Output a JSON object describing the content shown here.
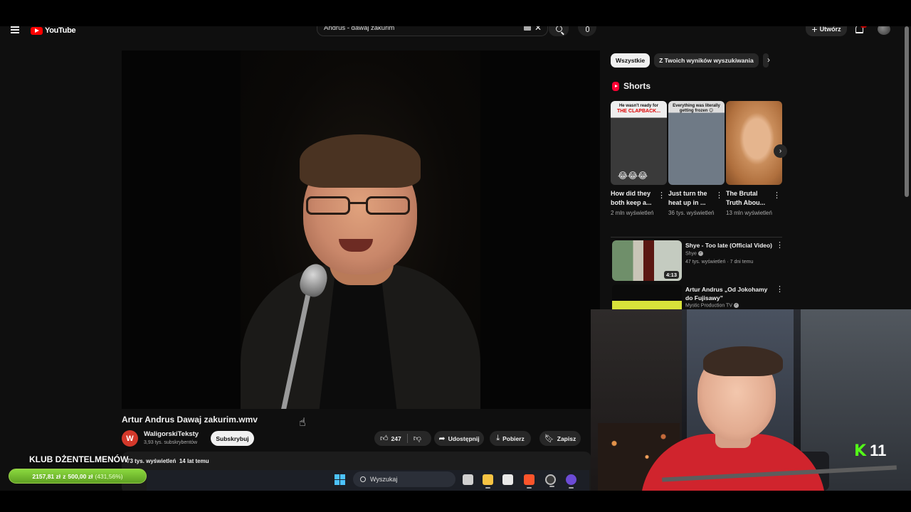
{
  "masthead": {
    "logo_text": "YouTube",
    "search_value": "Andrus - dawaj zakurim",
    "create_label": "Utwórz"
  },
  "video": {
    "title": "Artur Andrus Dawaj zakurim.wmv",
    "channel_initial": "W",
    "channel_name": "WaligorskiTeksty",
    "channel_subs": "3,93 tys. subskrybentów",
    "subscribe_label": "Subskrybuj",
    "likes": "247",
    "share_label": "Udostępnij",
    "download_label": "Pobierz",
    "save_label": "Zapisz",
    "views": "73 tys. wyświetleń",
    "age": "14 lat temu"
  },
  "sidebar": {
    "chips": [
      "Wszystkie",
      "Z Twoich wyników wyszukiwania"
    ],
    "shorts_heading": "Shorts",
    "shorts": [
      {
        "caption_top": "He wasn't ready for",
        "caption_red": "THE CLAPBACK...",
        "title": "How did they both keep a...",
        "views": "2 mln wyświetleń",
        "emoji": "😂😂😂"
      },
      {
        "caption_top": "Everything was literally getting frozen 😊",
        "caption_red": "",
        "title": "Just turn the heat up in ...",
        "views": "36 tys. wyświetleń",
        "emoji": ""
      },
      {
        "caption_top": "",
        "caption_red": "",
        "title": "The Brutal Truth Abou...",
        "views": "13 mln wyświetleń",
        "emoji": ""
      }
    ],
    "recommendations": [
      {
        "title": "Shye - Too late (Official Video)",
        "channel": "Shye",
        "meta": "47 tys. wyświetleń · 7 dni temu",
        "duration": "4:13"
      },
      {
        "title": "Artur Andrus „Od Jokohamy do Fujisawy”",
        "channel": "Mystic Production TV",
        "meta": "",
        "duration": ""
      }
    ]
  },
  "overlay": {
    "club_title": "KLUB DŻENTELMENÓW",
    "progress_current": "2157,81 zł",
    "progress_sep": "z",
    "progress_goal": "500,00 zł",
    "progress_pct": "(431,56%)",
    "progress_fraction": 1.0,
    "kick_number": "11"
  },
  "taskbar": {
    "search_label": "Wyszukaj"
  },
  "colors": {
    "accent_red": "#ff0000",
    "kick_green": "#53fc18",
    "progress_green": "#6cc22f",
    "windows_blue": "#4cc2ff"
  }
}
